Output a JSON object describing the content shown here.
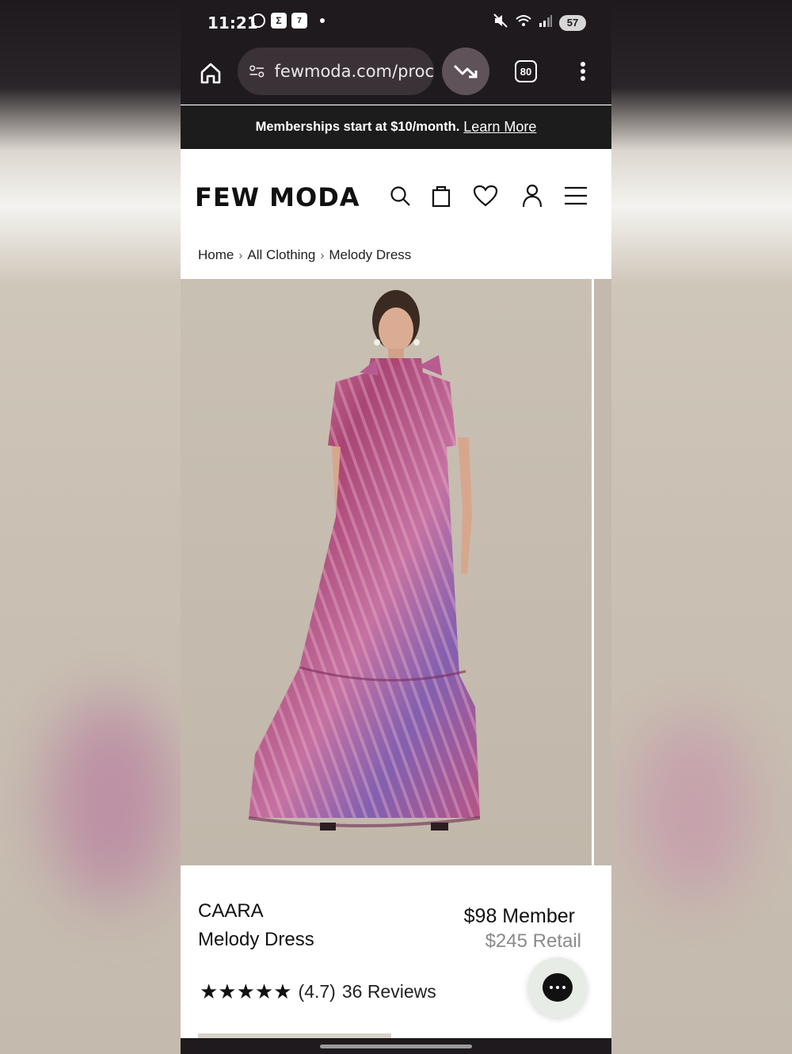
{
  "status_bar": {
    "time": "11:21",
    "battery": "57",
    "icons": [
      "whatsapp-icon",
      "sigma-icon",
      "calendar-icon",
      "dot-icon",
      "mute-icon",
      "wifi-icon",
      "signal-icon"
    ],
    "calendar_day": "7"
  },
  "browser": {
    "url": "fewmoda.com/proc",
    "tab_count": "80"
  },
  "promo": {
    "text": "Memberships start at $10/month.",
    "link": "Learn More"
  },
  "header": {
    "logo": "FEW MODA"
  },
  "breadcrumb": {
    "items": [
      "Home",
      "All Clothing",
      "Melody Dress"
    ],
    "separator": "›"
  },
  "product": {
    "brand": "CAARA",
    "name": "Melody Dress",
    "member_price": "$98 Member",
    "retail_price": "$245 Retail",
    "rating_value": 4.7,
    "rating_text": "(4.7)",
    "reviews": "36 Reviews",
    "stars": "★★★★★"
  },
  "colors": {
    "chrome": "#1f1a1e",
    "accent_pill": "#5f5259",
    "dress_primary": "#b0407a",
    "dress_secondary": "#6f4fa6"
  }
}
